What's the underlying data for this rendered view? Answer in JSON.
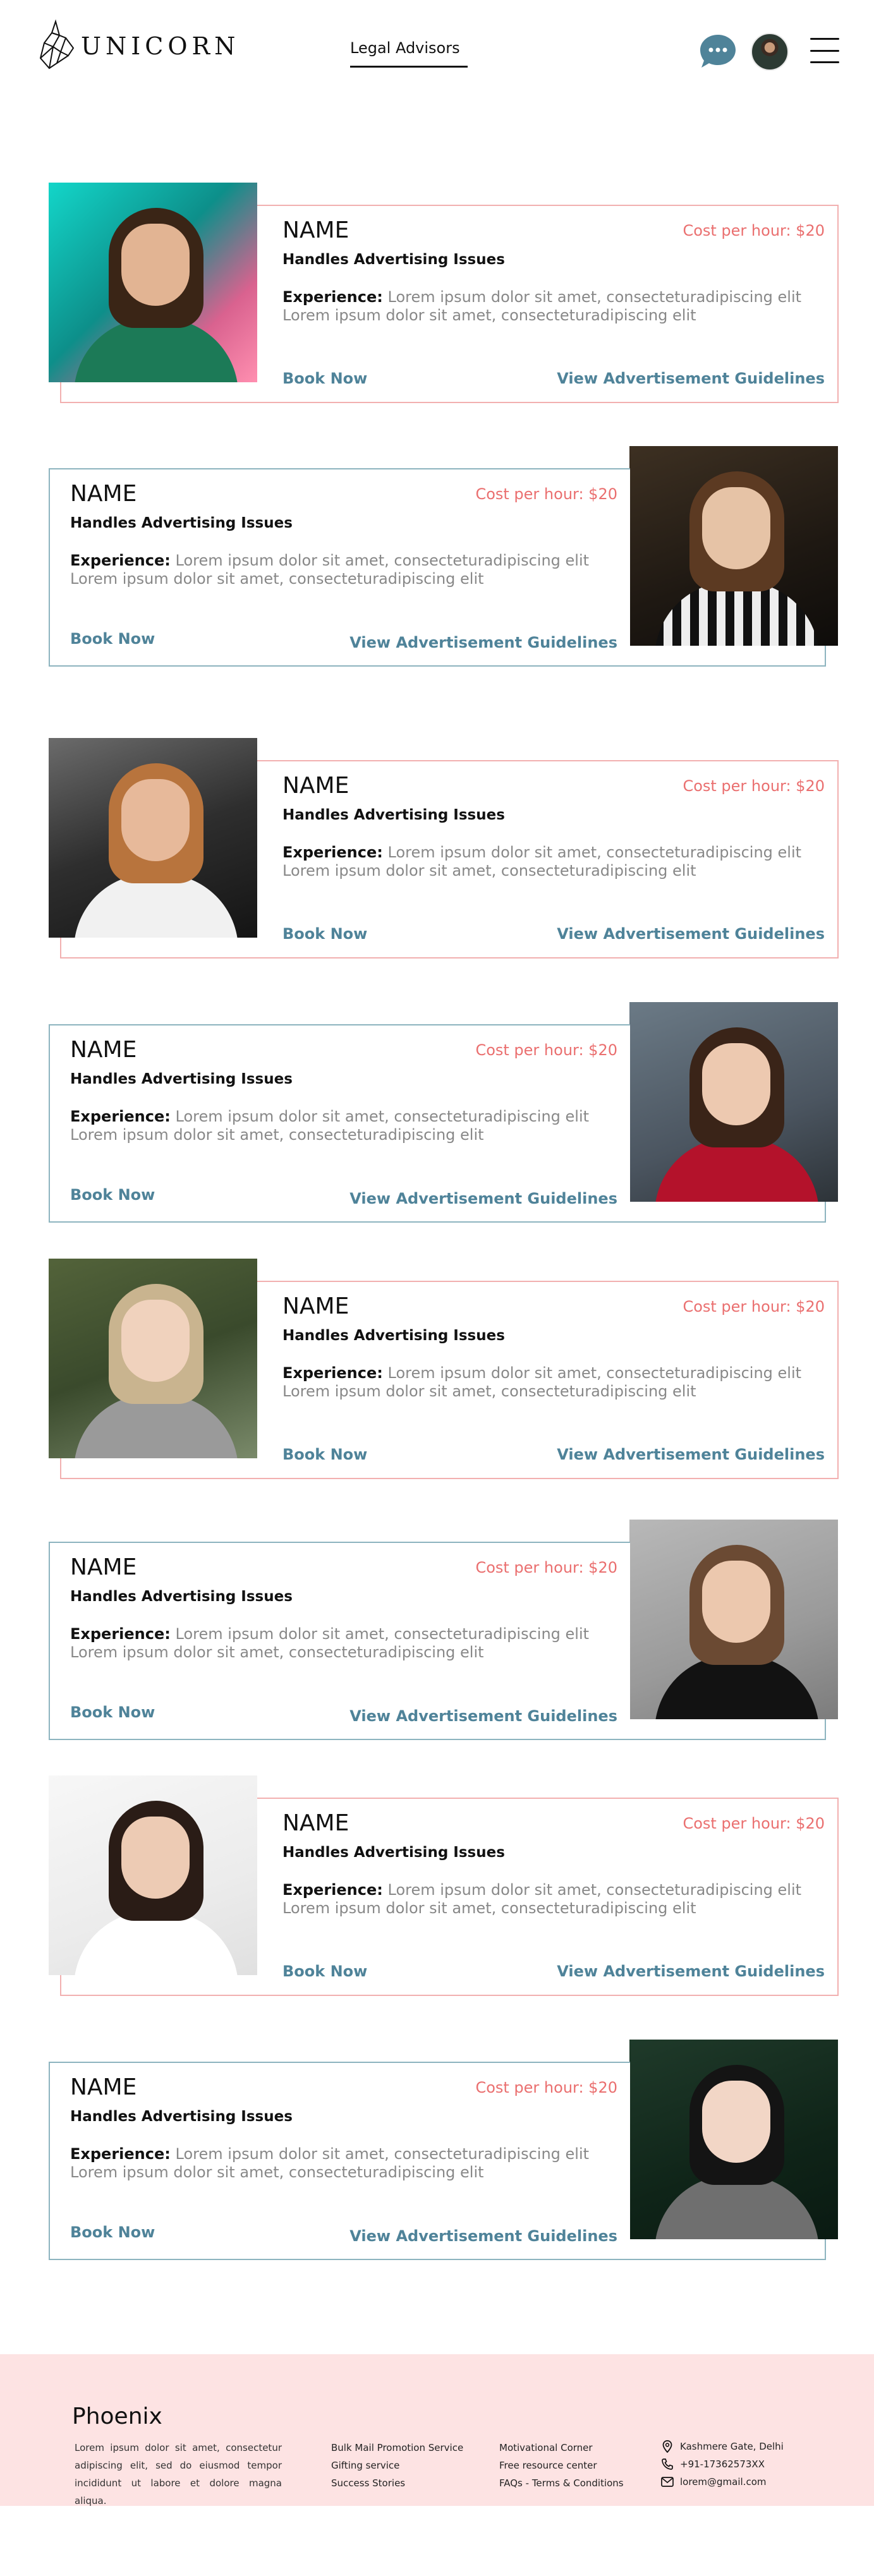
{
  "header": {
    "brand": "UNICORN",
    "nav_tab": "Legal Advisors",
    "icons": {
      "chat": "chat-bubble-icon",
      "menu": "hamburger-menu-icon"
    }
  },
  "advisors": [
    {
      "name": "NAME",
      "role": "Handles Advertising Issues",
      "cost": "Cost per hour: $20",
      "experience_label": "Experience:",
      "experience": "Lorem ipsum dolor sit amet, consecteturadipiscing elit Lorem ipsum dolor sit amet, consecteturadipiscing elit",
      "book": "Book Now",
      "guidelines": "View Advertisement Guidelines"
    },
    {
      "name": "NAME",
      "role": "Handles Advertising Issues",
      "cost": "Cost per hour: $20",
      "experience_label": "Experience:",
      "experience": "Lorem ipsum dolor sit amet, consecteturadipiscing elit Lorem ipsum dolor sit amet, consecteturadipiscing elit",
      "book": "Book Now",
      "guidelines": "View Advertisement Guidelines"
    },
    {
      "name": "NAME",
      "role": "Handles Advertising Issues",
      "cost": "Cost per hour: $20",
      "experience_label": "Experience:",
      "experience": "Lorem ipsum dolor sit amet, consecteturadipiscing elit Lorem ipsum dolor sit amet, consecteturadipiscing elit",
      "book": "Book Now",
      "guidelines": "View Advertisement Guidelines"
    },
    {
      "name": "NAME",
      "role": "Handles Advertising Issues",
      "cost": "Cost per hour: $20",
      "experience_label": "Experience:",
      "experience": "Lorem ipsum dolor sit amet, consecteturadipiscing elit Lorem ipsum dolor sit amet, consecteturadipiscing elit",
      "book": "Book Now",
      "guidelines": "View Advertisement Guidelines"
    },
    {
      "name": "NAME",
      "role": "Handles Advertising Issues",
      "cost": "Cost per hour: $20",
      "experience_label": "Experience:",
      "experience": "Lorem ipsum dolor sit amet, consecteturadipiscing elit Lorem ipsum dolor sit amet, consecteturadipiscing elit",
      "book": "Book Now",
      "guidelines": "View Advertisement Guidelines"
    },
    {
      "name": "NAME",
      "role": "Handles Advertising Issues",
      "cost": "Cost per hour: $20",
      "experience_label": "Experience:",
      "experience": "Lorem ipsum dolor sit amet, consecteturadipiscing elit Lorem ipsum dolor sit amet, consecteturadipiscing elit",
      "book": "Book Now",
      "guidelines": "View Advertisement Guidelines"
    },
    {
      "name": "NAME",
      "role": "Handles Advertising Issues",
      "cost": "Cost per hour: $20",
      "experience_label": "Experience:",
      "experience": "Lorem ipsum dolor sit amet, consecteturadipiscing elit Lorem ipsum dolor sit amet, consecteturadipiscing elit",
      "book": "Book Now",
      "guidelines": "View Advertisement Guidelines"
    },
    {
      "name": "NAME",
      "role": "Handles Advertising Issues",
      "cost": "Cost per hour: $20",
      "experience_label": "Experience:",
      "experience": "Lorem ipsum dolor sit amet, consecteturadipiscing elit Lorem ipsum dolor sit amet, consecteturadipiscing elit",
      "book": "Book Now",
      "guidelines": "View Advertisement Guidelines"
    }
  ],
  "footer": {
    "brand": "Phoenix",
    "description": "Lorem ipsum dolor sit amet, consectetur adipiscing elit, sed do eiusmod tempor incididunt ut labore et dolore magna aliqua.",
    "links_col1": [
      "Bulk Mail Promotion Service",
      "Gifting service",
      "Success Stories"
    ],
    "links_col2": [
      "Motivational Corner",
      "Free resource center",
      "FAQs - Terms & Conditions"
    ],
    "contact": {
      "address": "Kashmere Gate, Delhi",
      "phone": "+91-17362573XX",
      "email": "lorem@gmail.com"
    }
  },
  "colors": {
    "accent_pink": "#ea6f6f",
    "accent_teal": "#4f8399",
    "border_pink": "#f2b0b0",
    "border_teal": "#8db4bf",
    "footer_bg": "#fde3e3"
  }
}
